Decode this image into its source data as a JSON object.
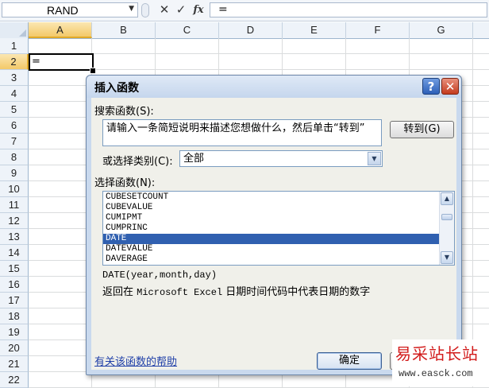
{
  "formula_bar": {
    "name_box": "RAND",
    "cancel_icon": "✕",
    "enter_icon": "✓",
    "fx_label": "fx",
    "formula": "="
  },
  "grid": {
    "columns": [
      "A",
      "B",
      "C",
      "D",
      "E",
      "F",
      "G"
    ],
    "rows": [
      "1",
      "2",
      "3",
      "4",
      "5",
      "6",
      "7",
      "8",
      "9",
      "10",
      "11",
      "12",
      "13",
      "14",
      "15",
      "16",
      "17",
      "18",
      "19",
      "20",
      "21",
      "22"
    ],
    "active_cell": "A2",
    "active_cell_value": "="
  },
  "dialog": {
    "title": "插入函数",
    "help_icon": "?",
    "close_icon": "✕",
    "search_label": "搜索函数(S):",
    "search_value": "请输入一条简短说明来描述您想做什么，然后单击“转到”",
    "go_button": "转到(G)",
    "category_label": "或选择类别(C):",
    "category_value": "全部",
    "select_label": "选择函数(N):",
    "functions": [
      "CUBESETCOUNT",
      "CUBEVALUE",
      "CUMIPMT",
      "CUMPRINC",
      "DATE",
      "DATEVALUE",
      "DAVERAGE"
    ],
    "selected_function": "DATE",
    "signature": "DATE(year,month,day)",
    "description_prefix": "返回在 ",
    "description_mono": "Microsoft Excel",
    "description_suffix": " 日期时间代码中代表日期的数字",
    "help_link": "有关该函数的帮助",
    "ok_button": "确定"
  },
  "watermark": {
    "title": "易采站长站",
    "url": "www.easck.com"
  },
  "colors": {
    "selection": "#3060b0",
    "active_header": "#f3c969",
    "dialog_frame": "#c9d9ee",
    "watermark_red": "#d21b1b"
  }
}
